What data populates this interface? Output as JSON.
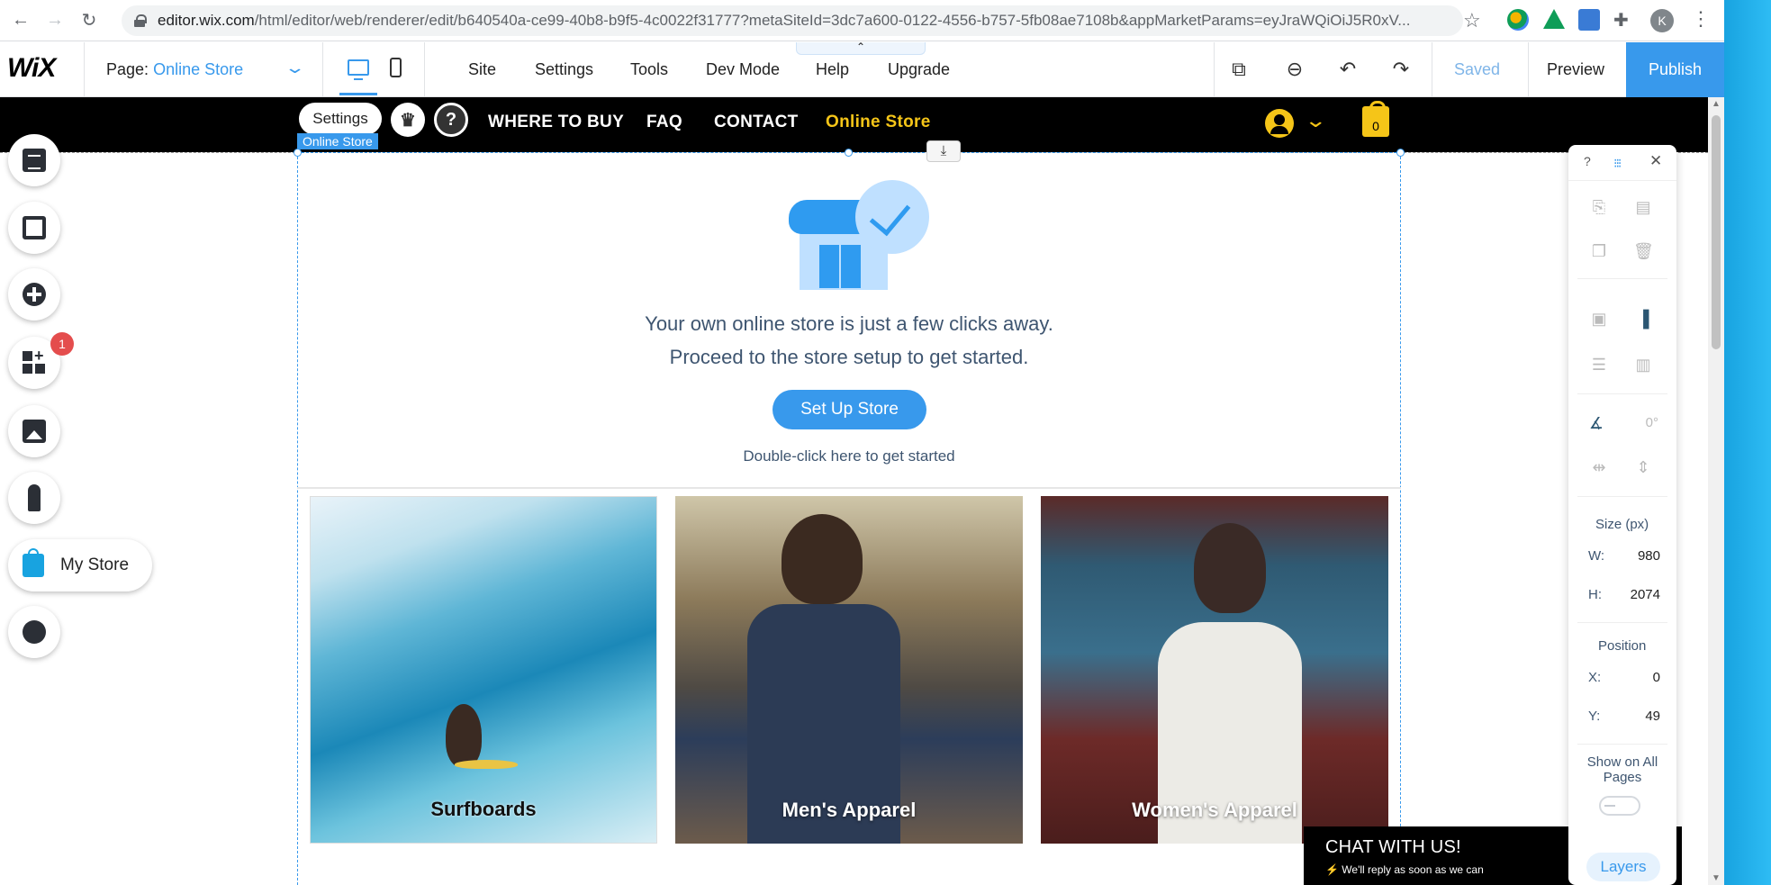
{
  "browser": {
    "url_host": "editor.wix.com",
    "url_path": "/html/editor/web/renderer/edit/b640540a-ce99-40b8-b9f5-4c0022f31777?metaSiteId=3dc7a600-0122-4556-b757-5fb08ae7108b&appMarketParams=eyJraWQiOiJ5R0xV...",
    "profile_initial": "K"
  },
  "editor_top": {
    "logo": "WiX",
    "page_label": "Page:",
    "page_value": "Online Store",
    "menu": [
      "Site",
      "Settings",
      "Tools",
      "Dev Mode",
      "Help",
      "Upgrade"
    ],
    "collapse_glyph": "⌃",
    "saved": "Saved",
    "preview": "Preview",
    "publish": "Publish"
  },
  "site_header": {
    "settings_label": "Settings",
    "nav": [
      "WHERE TO BUY",
      "FAQ",
      "CONTACT",
      "Online Store"
    ],
    "selection_tag": "Online Store",
    "cart_count": "0"
  },
  "store_section": {
    "line1": "Your own online store is just a few clicks away.",
    "line2": "Proceed to the store setup to get started.",
    "setup_button": "Set Up Store",
    "hint": "Double-click here to get started"
  },
  "tiles": [
    "Surfboards",
    "Men's Apparel",
    "Women's Apparel"
  ],
  "left_tools": {
    "apps_badge": "1",
    "my_store": "My Store"
  },
  "inspector": {
    "help": "?",
    "size_label": "Size (px)",
    "w_label": "W:",
    "w_value": "980",
    "h_label": "H:",
    "h_value": "2074",
    "position_label": "Position",
    "x_label": "X:",
    "x_value": "0",
    "y_label": "Y:",
    "y_value": "49",
    "rotation_value": "0°",
    "show_all_label": "Show on All Pages",
    "layers": "Layers"
  },
  "chat": {
    "title": "CHAT WITH US!",
    "subtitle": "We'll reply as soon as we can"
  },
  "colors": {
    "accent": "#3899ec",
    "header_bg": "#000000",
    "active_nav": "#f5c518",
    "badge": "#e44d4d"
  }
}
